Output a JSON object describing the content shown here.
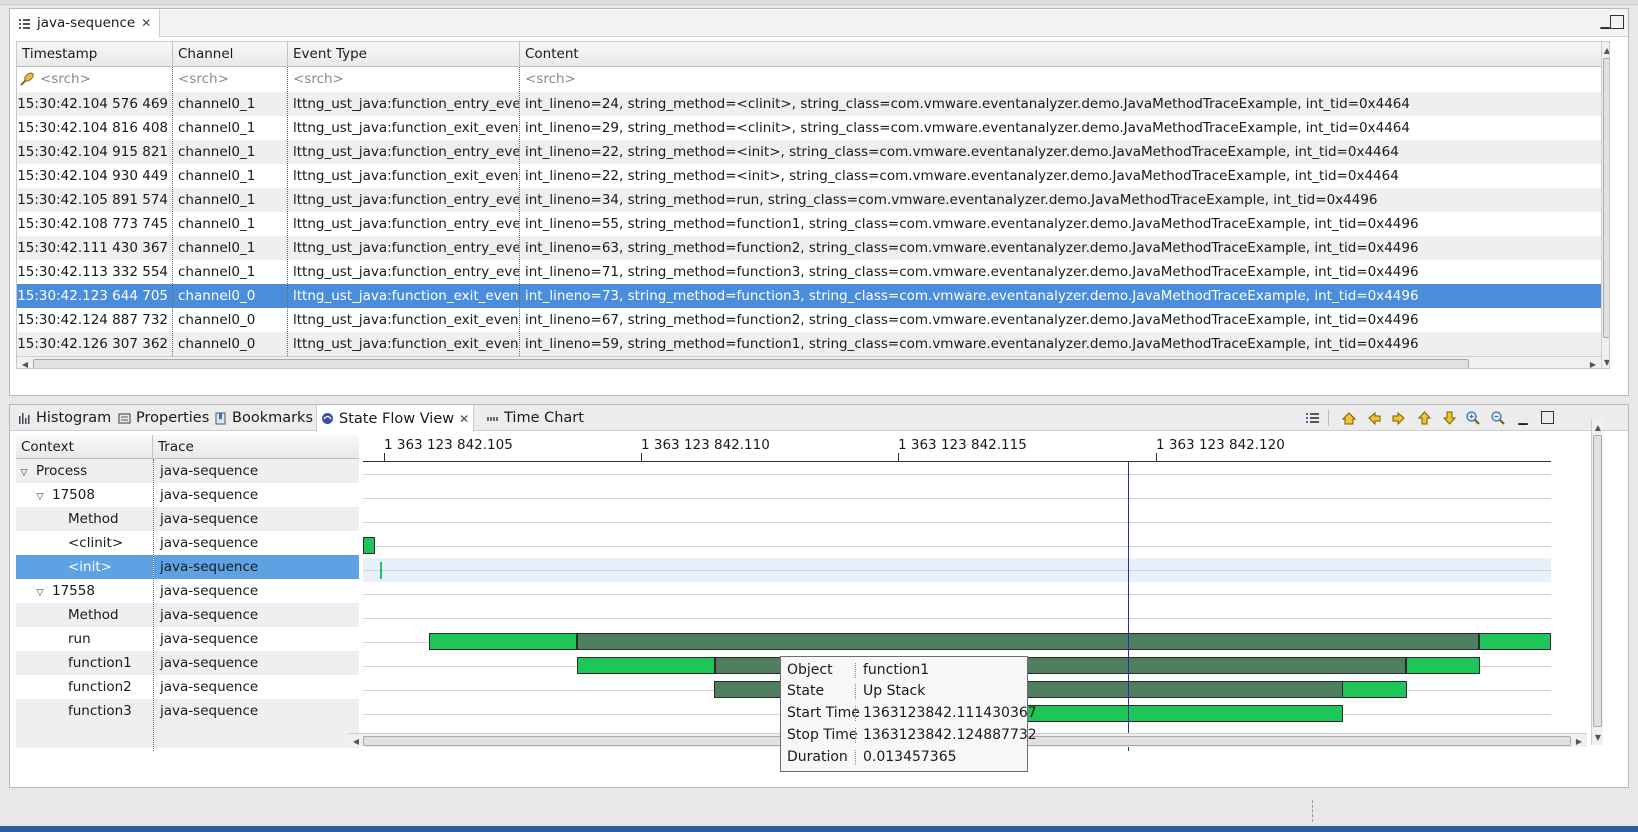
{
  "editor": {
    "tab_label": "java-sequence",
    "minimize_label": "▭",
    "maximize_label": "◻",
    "columns": [
      "Timestamp",
      "Channel",
      "Event Type",
      "Content"
    ],
    "search_placeholder": "<srch>",
    "rows": [
      {
        "timestamp": "15:30:42.104 576 469",
        "channel": "channel0_1",
        "event_type": "lttng_ust_java:function_entry_event",
        "content": "int_lineno=24, string_method=<clinit>, string_class=com.vmware.eventanalyzer.demo.JavaMethodTraceExample, int_tid=0x4464"
      },
      {
        "timestamp": "15:30:42.104 816 408",
        "channel": "channel0_1",
        "event_type": "lttng_ust_java:function_exit_event",
        "content": "int_lineno=29, string_method=<clinit>, string_class=com.vmware.eventanalyzer.demo.JavaMethodTraceExample, int_tid=0x4464"
      },
      {
        "timestamp": "15:30:42.104 915 821",
        "channel": "channel0_1",
        "event_type": "lttng_ust_java:function_entry_event",
        "content": "int_lineno=22, string_method=<init>, string_class=com.vmware.eventanalyzer.demo.JavaMethodTraceExample, int_tid=0x4464"
      },
      {
        "timestamp": "15:30:42.104 930 449",
        "channel": "channel0_1",
        "event_type": "lttng_ust_java:function_exit_event",
        "content": "int_lineno=22, string_method=<init>, string_class=com.vmware.eventanalyzer.demo.JavaMethodTraceExample, int_tid=0x4464"
      },
      {
        "timestamp": "15:30:42.105 891 574",
        "channel": "channel0_1",
        "event_type": "lttng_ust_java:function_entry_event",
        "content": "int_lineno=34, string_method=run, string_class=com.vmware.eventanalyzer.demo.JavaMethodTraceExample, int_tid=0x4496"
      },
      {
        "timestamp": "15:30:42.108 773 745",
        "channel": "channel0_1",
        "event_type": "lttng_ust_java:function_entry_event",
        "content": "int_lineno=55, string_method=function1, string_class=com.vmware.eventanalyzer.demo.JavaMethodTraceExample, int_tid=0x4496"
      },
      {
        "timestamp": "15:30:42.111 430 367",
        "channel": "channel0_1",
        "event_type": "lttng_ust_java:function_entry_event",
        "content": "int_lineno=63, string_method=function2, string_class=com.vmware.eventanalyzer.demo.JavaMethodTraceExample, int_tid=0x4496"
      },
      {
        "timestamp": "15:30:42.113 332 554",
        "channel": "channel0_1",
        "event_type": "lttng_ust_java:function_entry_event",
        "content": "int_lineno=71, string_method=function3, string_class=com.vmware.eventanalyzer.demo.JavaMethodTraceExample, int_tid=0x4496"
      },
      {
        "timestamp": "15:30:42.123 644 705",
        "channel": "channel0_0",
        "event_type": "lttng_ust_java:function_exit_event",
        "content": "int_lineno=73, string_method=function3, string_class=com.vmware.eventanalyzer.demo.JavaMethodTraceExample, int_tid=0x4496"
      },
      {
        "timestamp": "15:30:42.124 887 732",
        "channel": "channel0_0",
        "event_type": "lttng_ust_java:function_exit_event",
        "content": "int_lineno=67, string_method=function2, string_class=com.vmware.eventanalyzer.demo.JavaMethodTraceExample, int_tid=0x4496"
      },
      {
        "timestamp": "15:30:42.126 307 362",
        "channel": "channel0_0",
        "event_type": "lttng_ust_java:function_exit_event",
        "content": "int_lineno=59, string_method=function1, string_class=com.vmware.eventanalyzer.demo.JavaMethodTraceExample, int_tid=0x4496"
      }
    ],
    "selected_row": 8
  },
  "view": {
    "tabs": [
      "Histogram",
      "Properties",
      "Bookmarks",
      "State Flow View",
      "Time Chart"
    ],
    "active_tab": 3,
    "toolbar_icons": [
      "list-icon",
      "home-icon",
      "previous-event-icon",
      "next-event-icon",
      "previous-item-icon",
      "next-item-icon",
      "zoom-in-icon",
      "zoom-out-icon"
    ],
    "tree_columns": [
      "Context",
      "Trace"
    ],
    "tree_rows": [
      {
        "label": "Process",
        "trace": "java-sequence",
        "expand": "▽"
      },
      {
        "label": "17508",
        "trace": "java-sequence",
        "expand": "▽"
      },
      {
        "label": "Method",
        "trace": "java-sequence",
        "expand": ""
      },
      {
        "label": "<clinit>",
        "trace": "java-sequence",
        "expand": ""
      },
      {
        "label": "<init>",
        "trace": "java-sequence",
        "expand": ""
      },
      {
        "label": "17558",
        "trace": "java-sequence",
        "expand": "▽"
      },
      {
        "label": "Method",
        "trace": "java-sequence",
        "expand": ""
      },
      {
        "label": "run",
        "trace": "java-sequence",
        "expand": ""
      },
      {
        "label": "function1",
        "trace": "java-sequence",
        "expand": ""
      },
      {
        "label": "function2",
        "trace": "java-sequence",
        "expand": ""
      },
      {
        "label": "function3",
        "trace": "java-sequence",
        "expand": ""
      }
    ],
    "selected_tree_row": 4,
    "time_scale": [
      "1 363 123 842.105",
      "1 363 123 842.110",
      "1 363 123 842.115",
      "1 363 123 842.120"
    ],
    "tooltip": {
      "object_label": "Object",
      "object_value": "function1",
      "state_label": "State",
      "state_value": "Up Stack",
      "start_label": "Start Time",
      "start_value": "1363123842.111430367",
      "stop_label": "Stop Time",
      "stop_value": "1363123842.124887732",
      "duration_label": "Duration",
      "duration_value": "0.013457365"
    },
    "colors": {
      "active_state": "#1ec65a",
      "up_stack_state": "#4f7f5e",
      "selection": "#4a8edb",
      "cursor": "#2b2bb0"
    }
  }
}
